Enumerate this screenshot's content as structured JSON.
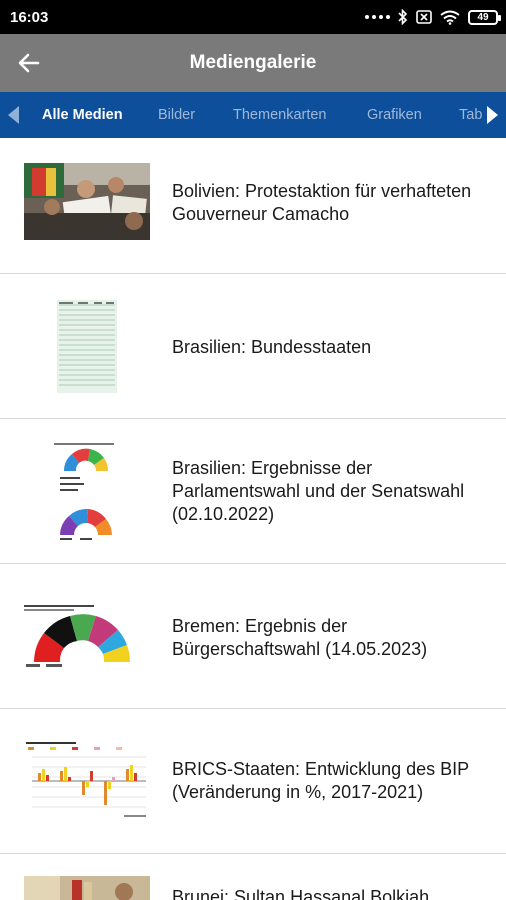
{
  "status_bar": {
    "time": "16:03",
    "battery": "49"
  },
  "app_bar": {
    "title": "Mediengalerie"
  },
  "tabs": [
    {
      "label": "Alle Medien",
      "active": true
    },
    {
      "label": "Bilder",
      "active": false
    },
    {
      "label": "Themenkarten",
      "active": false
    },
    {
      "label": "Grafiken",
      "active": false
    },
    {
      "label": "Tab",
      "active": false
    }
  ],
  "items": [
    {
      "title": "Bolivien: Protestaktion für verhafteten Gouverneur Camacho",
      "thumb": "photo"
    },
    {
      "title": "Brasilien: Bundesstaaten",
      "thumb": "table"
    },
    {
      "title": "Brasilien: Ergebnisse der Parlamentswahl und der Senatswahl (02.10.2022)",
      "thumb": "parliament-double"
    },
    {
      "title": "Bremen: Ergebnis der Bürgerschaftswahl (14.05.2023)",
      "thumb": "parliament-single"
    },
    {
      "title": "BRICS-Staaten: Entwicklung des BIP (Veränderung in %, 2017-2021)",
      "thumb": "bar-chart"
    },
    {
      "title": "Brunei: Sultan Hassanal Bolkiah",
      "thumb": "photo-portrait"
    }
  ],
  "colors": {
    "tab_bar": "#0d4f9a",
    "app_bar": "#7a7a7a",
    "status_bar": "#000000"
  }
}
